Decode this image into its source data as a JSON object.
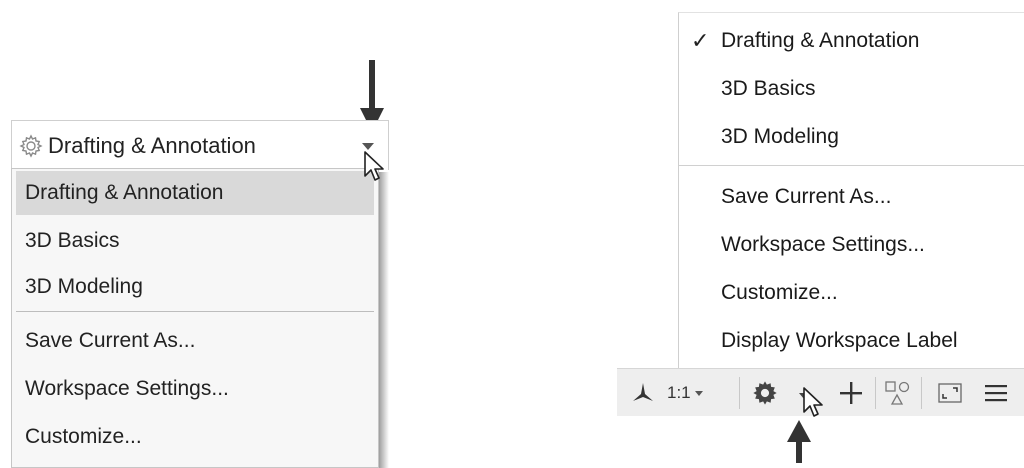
{
  "left_panel": {
    "workspace_switcher": {
      "current": "Drafting & Annotation",
      "icon": "gear-icon"
    },
    "menu_items": [
      {
        "label": "Drafting & Annotation",
        "selected": true
      },
      {
        "label": "3D Basics",
        "selected": false
      },
      {
        "label": "3D Modeling",
        "selected": false
      },
      {
        "label": "Save Current As...",
        "selected": false
      },
      {
        "label": "Workspace Settings...",
        "selected": false
      },
      {
        "label": "Customize...",
        "selected": false
      }
    ]
  },
  "right_panel": {
    "menu_items": [
      {
        "label": "Drafting & Annotation",
        "checked": true
      },
      {
        "label": "3D Basics",
        "checked": false
      },
      {
        "label": "3D Modeling",
        "checked": false
      },
      {
        "label": "Save Current As...",
        "checked": false
      },
      {
        "label": "Workspace Settings...",
        "checked": false
      },
      {
        "label": "Customize...",
        "checked": false
      },
      {
        "label": "Display Workspace Label",
        "checked": false
      }
    ],
    "check_glyph": "✓",
    "status_bar": {
      "annotation_scale": "1:1",
      "icons": [
        "annotation-visibility-icon",
        "gear-icon",
        "plus-icon",
        "isolate-objects-icon",
        "fullscreen-icon",
        "menu-icon"
      ]
    }
  }
}
